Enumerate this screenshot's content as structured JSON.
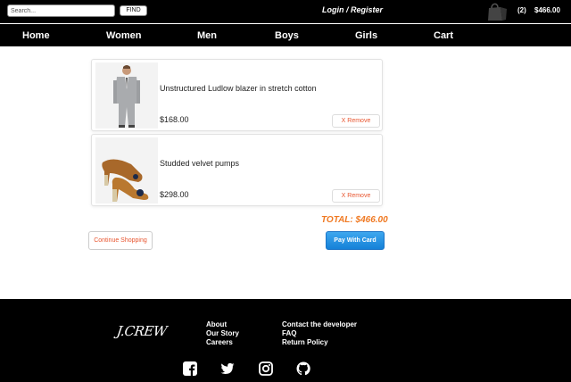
{
  "header": {
    "search_placeholder": "Search...",
    "find_label": "FIND",
    "login_label": "Login / Register",
    "cart_count": "(2)",
    "cart_total": "$466.00"
  },
  "nav": {
    "items": [
      "Home",
      "Women",
      "Men",
      "Boys",
      "Girls",
      "Cart"
    ]
  },
  "cart": {
    "items": [
      {
        "name": "Unstructured Ludlow blazer in stretch cotton",
        "price": "$168.00",
        "remove_label": "X Remove",
        "image": "gray-blazer"
      },
      {
        "name": "Studded velvet pumps",
        "price": "$298.00",
        "remove_label": "X Remove",
        "image": "velvet-pumps"
      }
    ],
    "total_label": "TOTAL: $466.00",
    "continue_label": "Continue Shopping",
    "pay_label": "Pay With Card"
  },
  "footer": {
    "logo": "J.CREW",
    "col1": [
      "About",
      "Our Story",
      "Careers"
    ],
    "col2": [
      "Contact the developer",
      "FAQ",
      "Return Policy"
    ],
    "social_icons": [
      "facebook-icon",
      "twitter-icon",
      "instagram-icon",
      "github-icon"
    ]
  },
  "colors": {
    "accent_orange": "#f07922",
    "remove_red": "#e8552f",
    "pay_blue": "#1581d8",
    "bar_black": "#000000"
  }
}
